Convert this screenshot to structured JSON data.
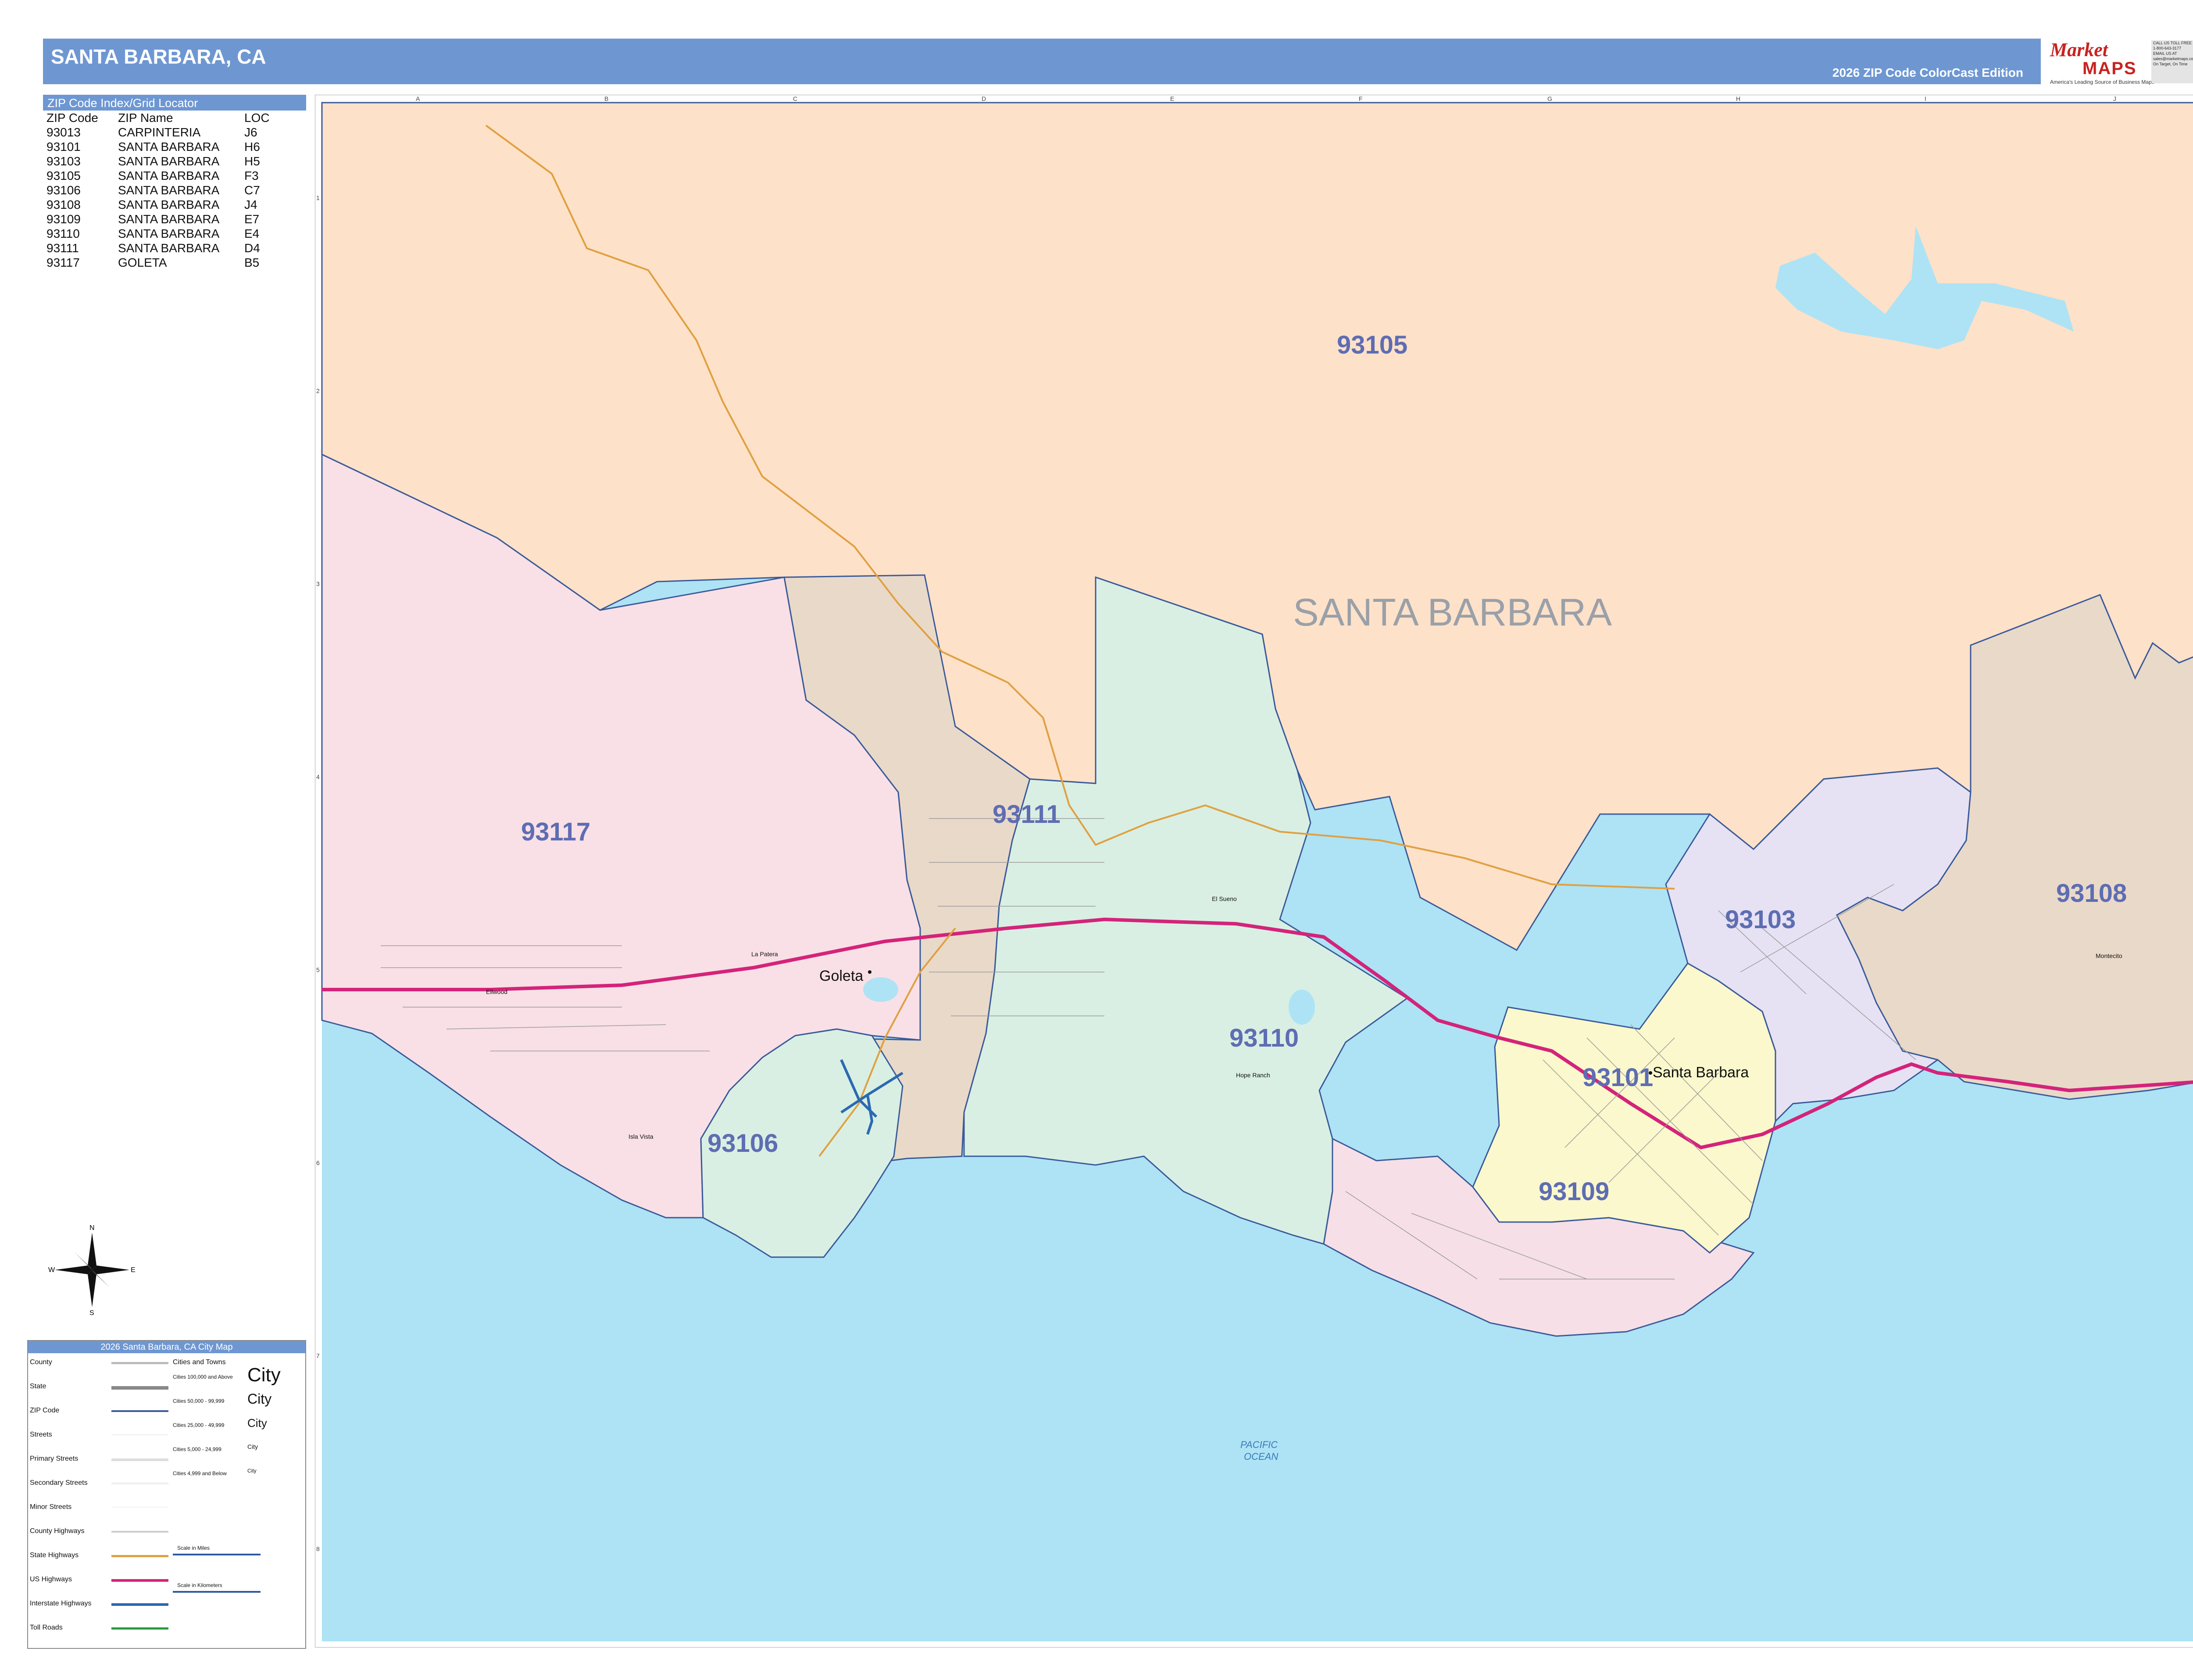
{
  "header": {
    "title": "SANTA BARBARA, CA",
    "edition": "2026 ZIP Code ColorCast Edition"
  },
  "logo": {
    "brand_top": "Market",
    "brand_bottom": "MAPS",
    "tagline": "America's Leading Source of Business Maps",
    "slogan": "On Target, On Time",
    "phone_lines": [
      "CALL US TOLL FREE",
      "1-800-643-3177",
      "EMAIL US AT",
      "sales@marketmaps.com"
    ]
  },
  "index": {
    "title": "ZIP Code Index/Grid Locator",
    "headers": [
      "ZIP Code",
      "ZIP Name",
      "LOC"
    ],
    "rows": [
      {
        "zip": "93013",
        "name": "CARPINTERIA",
        "loc": "J6"
      },
      {
        "zip": "93101",
        "name": "SANTA BARBARA",
        "loc": "H6"
      },
      {
        "zip": "93103",
        "name": "SANTA BARBARA",
        "loc": "H5"
      },
      {
        "zip": "93105",
        "name": "SANTA BARBARA",
        "loc": "F3"
      },
      {
        "zip": "93106",
        "name": "SANTA BARBARA",
        "loc": "C7"
      },
      {
        "zip": "93108",
        "name": "SANTA BARBARA",
        "loc": "J4"
      },
      {
        "zip": "93109",
        "name": "SANTA BARBARA",
        "loc": "E7"
      },
      {
        "zip": "93110",
        "name": "SANTA BARBARA",
        "loc": "E4"
      },
      {
        "zip": "93111",
        "name": "SANTA BARBARA",
        "loc": "D4"
      },
      {
        "zip": "93117",
        "name": "GOLETA",
        "loc": "B5"
      }
    ]
  },
  "map": {
    "grid_columns": [
      "A",
      "B",
      "C",
      "D",
      "E",
      "F",
      "G",
      "H",
      "I",
      "J"
    ],
    "grid_rows": [
      "1",
      "2",
      "3",
      "4",
      "5",
      "6",
      "7",
      "8"
    ],
    "city_label": "SANTA BARBARA",
    "zip_labels": {
      "z93105": "93105",
      "z93117": "93117",
      "z93111": "93111",
      "z93110": "93110",
      "z93106": "93106",
      "z93109": "93109",
      "z93101": "93101",
      "z93103": "93103",
      "z93108": "93108"
    },
    "places": {
      "goleta": "Goleta",
      "santa_barbara": "Santa Barbara",
      "la_patera": "La Patera",
      "ellwood": "Ellwood",
      "isla_vista": "Isla Vista",
      "el_sueno": "El Sueno",
      "hope_ranch": "Hope Ranch",
      "montecito": "Montecito"
    },
    "water_labels": {
      "ocean_1": "PACIFIC",
      "ocean_2": "OCEAN"
    },
    "colors": {
      "z93105": "#fde1c9",
      "z93117": "#f8e0e6",
      "z93111": "#e9d9c9",
      "z93110": "#d9efe3",
      "z93106": "#d9efe3",
      "z93109": "#f6dfe6",
      "z93101": "#faf8cc",
      "z93103": "#e6e2f3",
      "z93108": "#e9d9c9",
      "ocean": "#ade3f5",
      "zip_border": "#3a5a9a",
      "us_highway": "#d4237a",
      "state_highway": "#e0a040",
      "zip_label": "#5e6db3"
    }
  },
  "compass": {
    "n": "N",
    "s": "S",
    "e": "E",
    "w": "W"
  },
  "legend": {
    "title": "2026 Santa Barbara, CA City Map",
    "line_items": [
      "County",
      "State",
      "ZIP Code",
      "Streets",
      "Primary Streets",
      "Secondary Streets",
      "Minor Streets",
      "County Highways",
      "State Highways",
      "US Highways",
      "Interstate Highways",
      "Toll Roads"
    ],
    "cities_header": "Cities and Towns",
    "city_classes": [
      {
        "label": "Cities 100,000 and Above",
        "sample": "City"
      },
      {
        "label": "Cities 50,000 - 99,999",
        "sample": "City"
      },
      {
        "label": "Cities 25,000 - 49,999",
        "sample": "City"
      },
      {
        "label": "Cities 5,000 - 24,999",
        "sample": "City"
      },
      {
        "label": "Cities 4,999 and Below",
        "sample": "City"
      }
    ],
    "scale_miles": "Scale in Miles",
    "scale_km": "Scale in Kilometers"
  }
}
